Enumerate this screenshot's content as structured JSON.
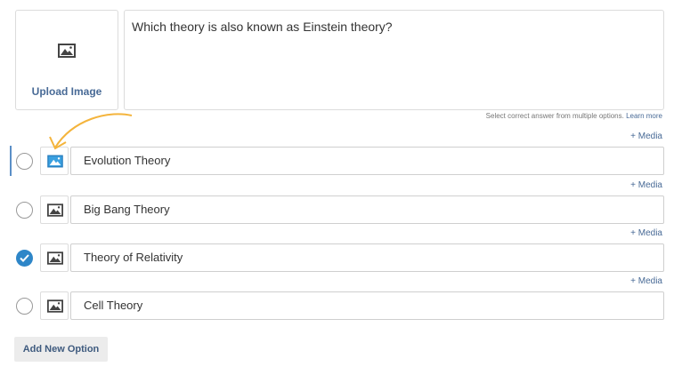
{
  "upload": {
    "label": "Upload Image",
    "icon": "image-icon"
  },
  "question": {
    "text": "Which theory is also known as Einstein theory?"
  },
  "hint": {
    "text": "Select correct answer from multiple options.",
    "learn_more": "Learn more"
  },
  "media_link": "+ Media",
  "options": [
    {
      "text": "Evolution Theory",
      "checked": false,
      "active": true
    },
    {
      "text": "Big Bang Theory",
      "checked": false,
      "active": false
    },
    {
      "text": "Theory of Relativity",
      "checked": true,
      "active": false
    },
    {
      "text": "Cell Theory",
      "checked": false,
      "active": false
    }
  ],
  "add_option_label": "Add New Option",
  "colors": {
    "accent": "#2e86c8",
    "link": "#486a96",
    "highlight_arrow": "#f4b43c",
    "active_icon": "#3aa0e0"
  }
}
